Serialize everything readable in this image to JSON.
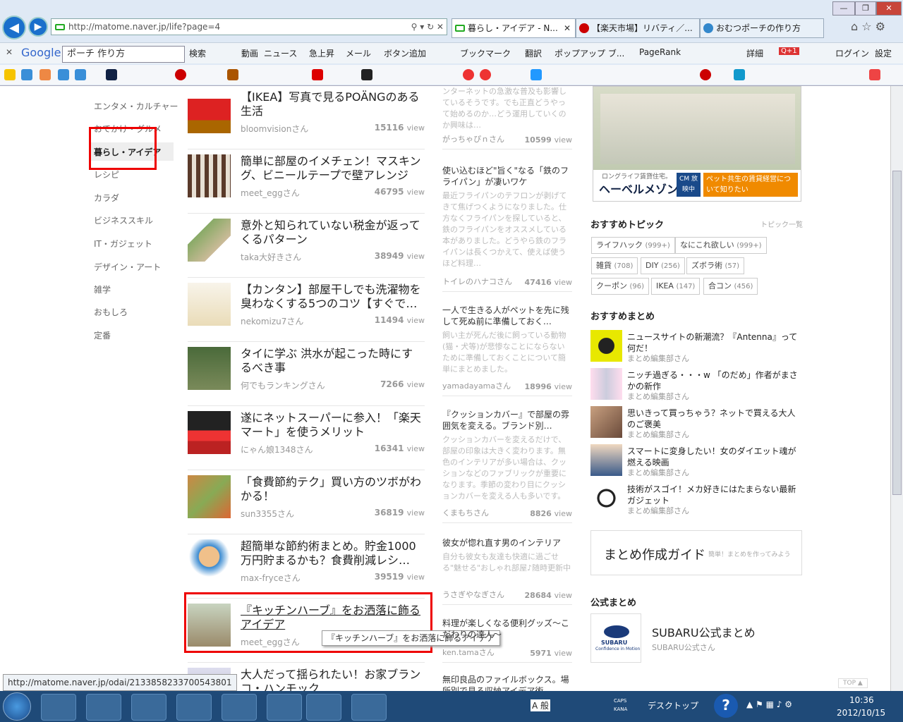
{
  "browser": {
    "address": "http://matome.naver.jp/life?page=4",
    "tabs": [
      "暮らし・アイデア - N...",
      "【楽天市場】リバティ／...",
      "おむつポーチの作り方"
    ],
    "search_query": "ポーチ 作り方",
    "google_label": "Google",
    "tools": [
      "検索",
      "動画",
      "ニュース",
      "急上昇",
      "メール",
      "ボタン追加",
      "ブックマーク",
      "翻訳",
      "ポップアップ ブ...",
      "PageRank",
      "詳細",
      "ログイン",
      "設定"
    ],
    "badge": "Q+1",
    "statusbar_url": "http://matome.naver.jp/odai/2133858233700543801",
    "tooltip": "『キッチンハーブ』をお洒落に飾るアイデア"
  },
  "categories": [
    "エンタメ・カルチャー",
    "おでかけ・グルメ",
    "暮らし・アイデア",
    "レシピ",
    "カラダ",
    "ビジネススキル",
    "IT・ガジェット",
    "デザイン・アート",
    "雑学",
    "おもしろ",
    "定番"
  ],
  "main_list": [
    {
      "title": "【IKEA】写真で見るPOÄNGのある生活",
      "author": "bloomvisionさん",
      "views": "15116",
      "unit": "view"
    },
    {
      "title": "簡単に部屋のイメチェン！マスキング、ビニールテープで壁アレンジ",
      "author": "meet_eggさん",
      "views": "46795",
      "unit": "view"
    },
    {
      "title": "意外と知られていない税金が返ってくるパターン",
      "author": "taka大好きさん",
      "views": "38949",
      "unit": "view"
    },
    {
      "title": "【カンタン】部屋干しでも洗濯物を臭わなくする5つのコツ【すぐで…",
      "author": "nekomizu7さん",
      "views": "11494",
      "unit": "view"
    },
    {
      "title": "タイに学ぶ 洪水が起こった時にするべき事",
      "author": "何でもランキングさん",
      "views": "7266",
      "unit": "view"
    },
    {
      "title": "遂にネットスーパーに参入！「楽天マート」を使うメリット",
      "author": "にゃん娘1348さん",
      "views": "16341",
      "unit": "view"
    },
    {
      "title": "「食費節約テク」買い方のツボがわかる！",
      "author": "sun3355さん",
      "views": "36819",
      "unit": "view"
    },
    {
      "title": "超簡単な節約術まとめ。貯金1000万円貯まるかも？食費削減レシ…",
      "author": "max-fryceさん",
      "views": "39519",
      "unit": "view"
    },
    {
      "title": "『キッチンハーブ』をお洒落に飾るアイデア",
      "author": "meet_eggさん",
      "views": "",
      "unit": ""
    },
    {
      "title": "大人だって揺られたい！お家ブランコ・ハンモック",
      "author": "",
      "views": "",
      "unit": ""
    }
  ],
  "mid_list": [
    {
      "title": "",
      "snippet": "ンターネットの急激な普及も影響しているそうです。でも正直どうやって始めるのか…どう運用していくのか興味は…",
      "author": "がっちゃぴｎさん",
      "views": "10599",
      "unit": "view"
    },
    {
      "title": "使い込むほど\"旨く\"なる「鉄のフライパン」が凄いワケ",
      "snippet": "最近フライパンのテフロンが剥げてきて焦げつくようになりました。仕方なくフライパンを探していると、鉄のフライパンをオススメしている本がありました。どうやら鉄のフライパンは長くつかえて、使えば使うほど料理…",
      "author": "トイレのハナコさん",
      "views": "47416",
      "unit": "view"
    },
    {
      "title": "一人で生きる人がペットを先に残して死ぬ前に準備しておく…",
      "snippet": "飼い主が死んだ後に飼っている動物(猫・犬等)が悲惨なことにならないために準備しておくことについて簡単にまとめました。",
      "author": "yamadayamaさん",
      "views": "18996",
      "unit": "view"
    },
    {
      "title": "『クッションカバー』で部屋の雰囲気を変える。ブランド別…",
      "snippet": "クッションカバーを変えるだけで、部屋の印象は大きく変わります。無色のインテリアが多い場合は、クッションなどのファブリックが重要になります。季節の変わり目にクッションカバーを変える人も多いです。",
      "author": "くまもちさん",
      "views": "8826",
      "unit": "view"
    },
    {
      "title": "彼女が惚れ直す男のインテリア",
      "snippet": "自分も彼女も友達も快適に過ごせる\"魅せる\"おしゃれ部屋♪随時更新中",
      "author": "うさぎやなぎさん",
      "views": "28684",
      "unit": "view"
    },
    {
      "title": "料理が楽しくなる便利グッズ〜こだわりの達人〜",
      "snippet": "",
      "author": "ken.tamaさん",
      "views": "5971",
      "unit": "view"
    },
    {
      "title": "無印良品のファイルボックス。場所別で見る収納アイデア術",
      "snippet": "",
      "author": "",
      "views": "",
      "unit": ""
    }
  ],
  "ad": {
    "brand": "ヘーベルメゾン",
    "tagline": "ロングライフ賃貸住宅。",
    "cta": "ペット共生の賃貸経営について知りたい",
    "cm": "CM 放映中"
  },
  "topics": {
    "heading": "おすすめトピック",
    "link": "トピック一覧",
    "tags": [
      {
        "name": "ライフハック",
        "count": "(999+)"
      },
      {
        "name": "なにこれ欲しい",
        "count": "(999+)"
      },
      {
        "name": "雑貨",
        "count": "(708)"
      },
      {
        "name": "DIY",
        "count": "(256)"
      },
      {
        "name": "ズボラ術",
        "count": "(57)"
      },
      {
        "name": "クーポン",
        "count": "(96)"
      },
      {
        "name": "IKEA",
        "count": "(147)"
      },
      {
        "name": "合コン",
        "count": "(456)"
      }
    ]
  },
  "recommended": {
    "heading": "おすすめまとめ",
    "items": [
      {
        "title": "ニュースサイトの新潮流？『Antenna』って何だ！",
        "author": "まとめ編集部さん"
      },
      {
        "title": "ニッチ過ぎる・・・w 「のだめ」作者がまさかの新作",
        "author": "まとめ編集部さん"
      },
      {
        "title": "思いきって買っちゃう？ネットで買える大人のご褒美",
        "author": "まとめ編集部さん"
      },
      {
        "title": "スマートに変身したい！女のダイエット魂が燃える映画",
        "author": "まとめ編集部さん"
      },
      {
        "title": "技術がスゴイ！メカ好きにはたまらない最新ガジェット",
        "author": "まとめ編集部さん"
      }
    ]
  },
  "guide": {
    "title": "まとめ作成ガイド",
    "sub": "簡単！まとめを作ってみよう"
  },
  "official": {
    "heading": "公式まとめ",
    "name": "SUBARU公式まとめ",
    "author": "SUBARU公式さん",
    "logo": "SUBARU",
    "logo_sub": "Confidence in Motion"
  },
  "top_label": "TOP ▲",
  "taskbar": {
    "desktop": "デスクトップ",
    "time": "10:36",
    "date": "2012/10/15",
    "ime": "A 般",
    "caps": "CAPS",
    "kana": "KANA"
  }
}
